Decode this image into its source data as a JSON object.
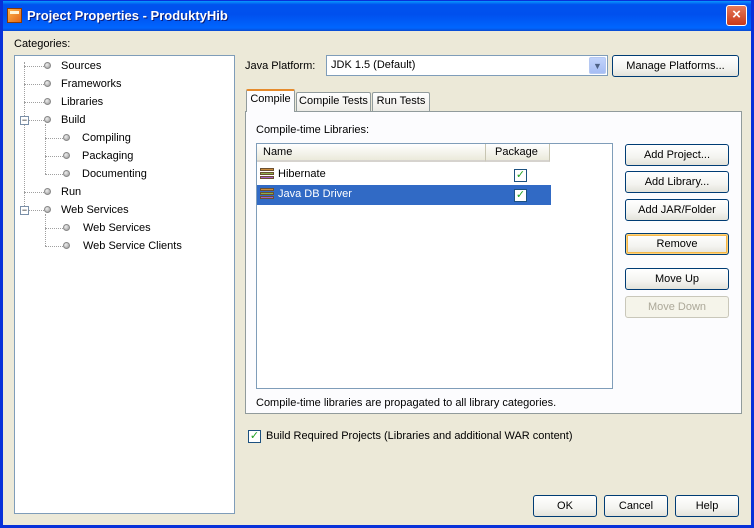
{
  "window": {
    "title": "Project Properties - ProduktyHib",
    "close_glyph": "×"
  },
  "categories": {
    "label": "Categories:",
    "items": [
      {
        "label": "Sources"
      },
      {
        "label": "Frameworks"
      },
      {
        "label": "Libraries"
      },
      {
        "label": "Build",
        "expander": "−"
      },
      {
        "label": "Compiling"
      },
      {
        "label": "Packaging"
      },
      {
        "label": "Documenting"
      },
      {
        "label": "Run"
      },
      {
        "label": "Web Services",
        "expander": "−"
      },
      {
        "label": "Web Services"
      },
      {
        "label": "Web Service Clients"
      }
    ]
  },
  "platform": {
    "label": "Java Platform:",
    "value": "JDK 1.5 (Default)",
    "dropdown_glyph": "▼",
    "manage_label": "Manage Platforms..."
  },
  "tabs": [
    {
      "label": "Compile"
    },
    {
      "label": "Compile Tests"
    },
    {
      "label": "Run Tests"
    }
  ],
  "compile": {
    "section_label": "Compile-time Libraries:",
    "columns": {
      "name": "Name",
      "package": "Package"
    },
    "rows": [
      {
        "name": "Hibernate",
        "package_checked": true,
        "check_glyph": "✓"
      },
      {
        "name": "Java DB Driver",
        "package_checked": true,
        "check_glyph": "✓"
      }
    ],
    "buttons": {
      "add_project": "Add Project...",
      "add_library": "Add Library...",
      "add_jar": "Add JAR/Folder",
      "remove": "Remove",
      "move_up": "Move Up",
      "move_down": "Move Down"
    },
    "propagated_note": "Compile-time libraries are propagated to all library categories."
  },
  "build_required": {
    "label": "Build Required Projects (Libraries and additional WAR content)",
    "checked": true,
    "check_glyph": "✓"
  },
  "footer": {
    "ok": "OK",
    "cancel": "Cancel",
    "help": "Help"
  },
  "colors": {
    "titlebar": "#0053ee",
    "selection": "#316ac5",
    "tab_accent": "#e68b2c"
  }
}
